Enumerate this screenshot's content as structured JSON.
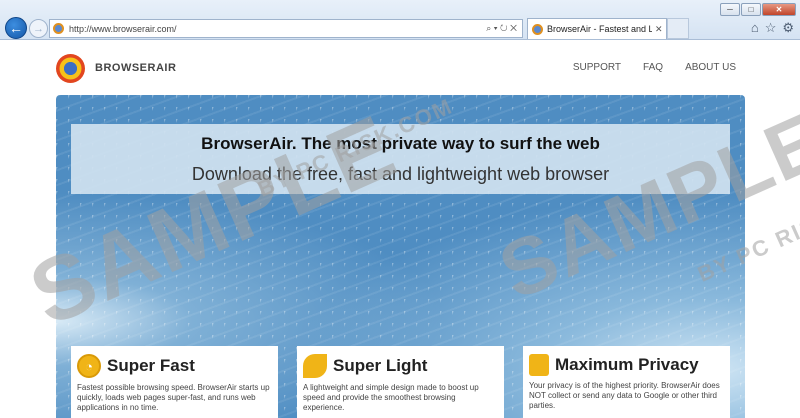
{
  "browser": {
    "url": "http://www.browserair.com/",
    "address_buttons": "⌕ ▾ ↻ ✕",
    "tab_title": "BrowserAir - Fastest and Li...",
    "tab_close": "✕",
    "window_buttons": {
      "minimize": "─",
      "maximize": "□",
      "close": "✕"
    },
    "tools": {
      "home": "⌂",
      "favorites": "☆",
      "settings": "⚙"
    }
  },
  "site": {
    "brand": "BROWSERAIR",
    "nav": [
      "SUPPORT",
      "FAQ",
      "ABOUT US"
    ]
  },
  "hero": {
    "headline": "BrowserAir. The most private way to surf the web",
    "subline": "Download the free, fast and lightweight web browser"
  },
  "features": [
    {
      "title": "Super Fast",
      "icon": "speedometer-icon",
      "text": "Fastest possible browsing speed. BrowserAir starts up quickly, loads web pages super-fast, and runs web applications in no time."
    },
    {
      "title": "Super Light",
      "icon": "leaf-icon",
      "text": "A lightweight and simple design made to boost up speed and provide the smoothest browsing experience."
    },
    {
      "title": "Maximum Privacy",
      "icon": "lock-icon",
      "text": "Your privacy is of the highest priority. BrowserAir does NOT collect or send any data to Google or other third parties."
    }
  ],
  "watermark": {
    "word": "SAMPLE",
    "by": "BY PC RISK.COM"
  }
}
